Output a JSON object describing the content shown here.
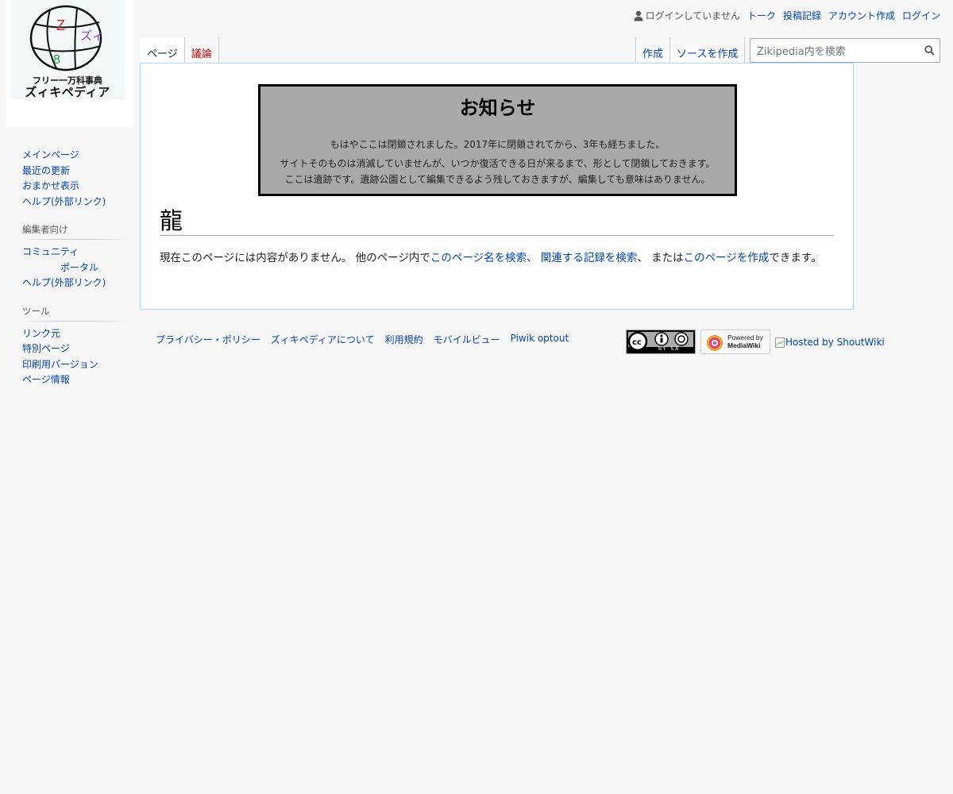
{
  "logo": {
    "subtitle": "フリー一万科事典",
    "name": "ズィキペディア"
  },
  "personal": {
    "anon": "ログインしていません",
    "items": [
      "トーク",
      "投稿記録",
      "アカウント作成",
      "ログイン"
    ]
  },
  "tabs": {
    "left": [
      {
        "label": "ページ",
        "selected": true
      },
      {
        "label": "議論",
        "new": true
      }
    ],
    "right": [
      {
        "label": "作成"
      },
      {
        "label": "ソースを作成"
      }
    ]
  },
  "search": {
    "placeholder": "Zikipedia内を検索"
  },
  "notice": {
    "title": "お知らせ",
    "line1": "もはやここは閉鎖されました。2017年に閉鎖されてから、3年も経ちました。",
    "line2": "サイトそのものは消滅していませんが、いつか復活できる日が来るまで、形として閉鎖しておきます。",
    "line3": "ここは遺跡です。遺跡公園として編集できるよう残しておきますが、編集しても意味はありません。"
  },
  "page": {
    "title": "龍",
    "text_prefix": "現在このページには内容がありません。 他のページ内で",
    "link_search_title": "このページ名を検索",
    "sep1": "、 ",
    "link_search_logs": "関連する記録を検索",
    "sep2": "、 または",
    "link_create": "このページを作成",
    "text_suffix": "できます。"
  },
  "sidebar": {
    "navigation": [
      "メインページ",
      "最近の更新",
      "おまかせ表示",
      "ヘルプ(外部リンク)"
    ],
    "editors": {
      "heading": "編集者向け",
      "community_line1": "コミュニティ",
      "community_line2": "ポータル",
      "help": "ヘルプ(外部リンク)"
    },
    "tools": {
      "heading": "ツール",
      "items": [
        "リンク元",
        "特別ページ",
        "印刷用バージョン",
        "ページ情報"
      ]
    }
  },
  "footer": {
    "links": [
      "プライバシー・ポリシー",
      "ズィキペディアについて",
      "利用規約",
      "モバイルビュー",
      "Piwik optout"
    ],
    "cc_label": "BY SA",
    "mw_powered": "Powered by",
    "mw_name": "MediaWiki",
    "shoutwiki": "Hosted by ShoutWiki"
  },
  "colors": {
    "link": "#0645ad",
    "new_link": "#ba0000",
    "notice_bg": "#a9a9a9",
    "content_border": "#a7d7f9"
  }
}
